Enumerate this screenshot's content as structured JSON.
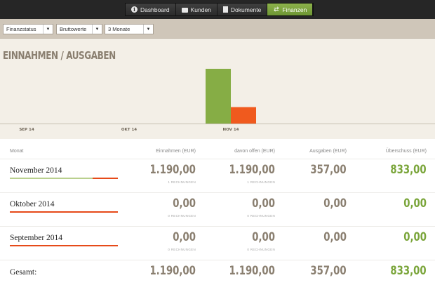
{
  "nav": {
    "items": [
      {
        "label": "Dashboard",
        "icon": "info-icon",
        "active": false
      },
      {
        "label": "Kunden",
        "icon": "briefcase-icon",
        "active": false
      },
      {
        "label": "Dokumente",
        "icon": "document-icon",
        "active": false
      },
      {
        "label": "Finanzen",
        "icon": "swap-icon",
        "active": true
      }
    ],
    "accent": "#7ea53f"
  },
  "filters": {
    "view": "Finanzstatus",
    "values": "Bruttowerte",
    "period": "3 Monate"
  },
  "chart": {
    "title": "EINNAHMEN / AUSGABEN"
  },
  "chart_data": {
    "type": "bar",
    "categories": [
      "SEP 14",
      "OKT 14",
      "NOV 14"
    ],
    "series": [
      {
        "name": "Einnahmen",
        "color": "#86ad45",
        "values": [
          0,
          0,
          1190
        ]
      },
      {
        "name": "Ausgaben",
        "color": "#f05a1e",
        "values": [
          0,
          0,
          357
        ]
      }
    ],
    "ylim": [
      0,
      1190
    ]
  },
  "table": {
    "headers": {
      "month": "Monat",
      "income": "Einnahmen (EUR)",
      "open": "davon offen (EUR)",
      "expenses": "Ausgaben (EUR)",
      "surplus": "Überschuss (EUR)"
    },
    "rows": [
      {
        "month": "November 2014",
        "income": "1.190,00",
        "income_sub": "1 RECHNUNGEN",
        "open": "1.190,00",
        "open_sub": "1 RECHNUNGEN",
        "expenses": "357,00",
        "surplus": "833,00",
        "income_share": 0.77
      },
      {
        "month": "Oktober 2014",
        "income": "0,00",
        "income_sub": "0 RECHNUNGEN",
        "open": "0,00",
        "open_sub": "0 RECHNUNGEN",
        "expenses": "0,00",
        "surplus": "0,00",
        "income_share": 0
      },
      {
        "month": "September 2014",
        "income": "0,00",
        "income_sub": "0 RECHNUNGEN",
        "open": "0,00",
        "open_sub": "0 RECHNUNGEN",
        "expenses": "0,00",
        "surplus": "0,00",
        "income_share": 0
      }
    ],
    "total": {
      "label": "Gesamt:",
      "income": "1.190,00",
      "open": "1.190,00",
      "expenses": "357,00",
      "surplus": "833,00"
    }
  }
}
